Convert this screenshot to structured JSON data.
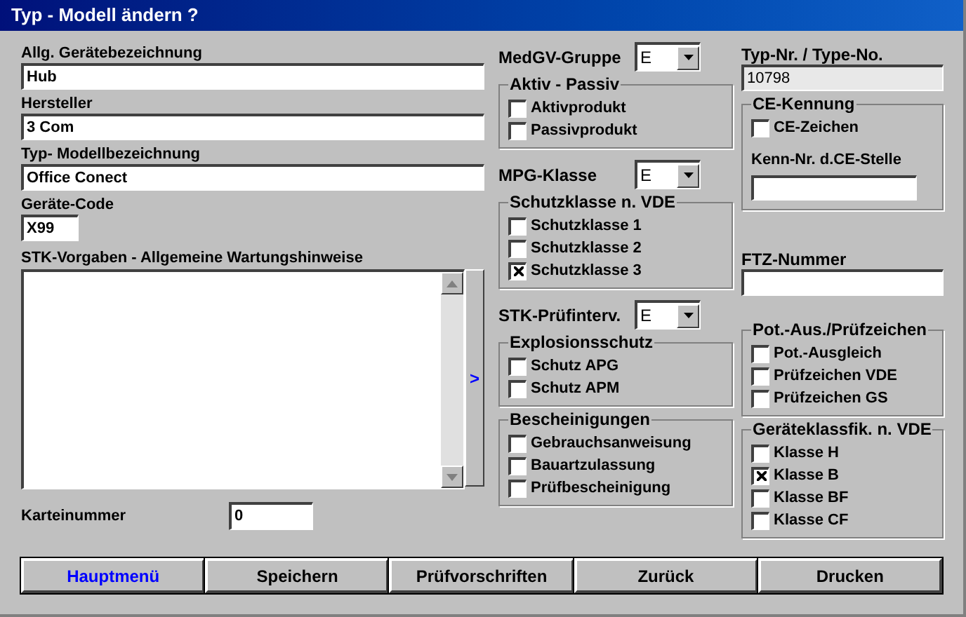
{
  "window": {
    "title": "Typ - Modell ändern ?"
  },
  "left": {
    "fields": [
      {
        "label": "Allg. Gerätebezeichnung",
        "value": "Hub"
      },
      {
        "label": "Hersteller",
        "value": "3 Com"
      },
      {
        "label": "Typ- Modellbezeichnung",
        "value": "Office Conect"
      },
      {
        "label": "Geräte-Code",
        "value": "X99"
      }
    ],
    "notes": {
      "label": "STK-Vorgaben - Allgemeine Wartungshinweise",
      "expand": ">"
    },
    "card_number": {
      "label": "Karteinummer",
      "value": "0"
    }
  },
  "middle": [
    {
      "kind": "dropdown",
      "label": "MedGV-Gruppe",
      "value": "E"
    },
    {
      "kind": "group",
      "title": "Aktiv - Passiv",
      "checks": [
        {
          "label": "Aktivprodukt",
          "checked": false
        },
        {
          "label": "Passivprodukt",
          "checked": false
        }
      ]
    },
    {
      "kind": "dropdown",
      "label": "MPG-Klasse",
      "value": "E"
    },
    {
      "kind": "group",
      "title": "Schutzklasse n. VDE",
      "checks": [
        {
          "label": "Schutzklasse 1",
          "checked": false
        },
        {
          "label": "Schutzklasse 2",
          "checked": false
        },
        {
          "label": "Schutzklasse 3",
          "checked": true
        }
      ]
    },
    {
      "kind": "dropdown",
      "label": "STK-Prüfinterv.",
      "value": "E"
    },
    {
      "kind": "group",
      "title": "Explosionsschutz",
      "checks": [
        {
          "label": "Schutz APG",
          "checked": false
        },
        {
          "label": "Schutz APM",
          "checked": false
        }
      ]
    },
    {
      "kind": "group",
      "title": "Bescheinigungen",
      "checks": [
        {
          "label": "Gebrauchsanweisung",
          "checked": false
        },
        {
          "label": "Bauartzulassung",
          "checked": false
        },
        {
          "label": "Prüfbescheinigung",
          "checked": false
        }
      ]
    }
  ],
  "right": [
    {
      "kind": "field",
      "label": "Typ-Nr. / Type-No.",
      "value": "10798",
      "readonly": true
    },
    {
      "kind": "group",
      "title": "CE-Kennung",
      "checks": [
        {
          "label": "CE-Zeichen",
          "checked": false
        }
      ],
      "field": {
        "label": "Kenn-Nr. d.CE-Stelle"
      }
    },
    {
      "kind": "field",
      "label": "FTZ-Nummer",
      "readonly": false
    },
    {
      "kind": "group",
      "title": "Pot.-Aus./Prüfzeichen",
      "checks": [
        {
          "label": "Pot.-Ausgleich",
          "checked": false
        },
        {
          "label": "Prüfzeichen VDE",
          "checked": false
        },
        {
          "label": "Prüfzeichen GS",
          "checked": false
        }
      ]
    },
    {
      "kind": "group",
      "title": "Geräteklassfik. n. VDE",
      "checks": [
        {
          "label": "Klasse H",
          "checked": false
        },
        {
          "label": "Klasse B",
          "checked": true
        },
        {
          "label": "Klasse BF",
          "checked": false
        },
        {
          "label": "Klasse CF",
          "checked": false
        }
      ]
    }
  ],
  "buttons": [
    {
      "label": "Hauptmenü",
      "highlighted": true
    },
    {
      "label": "Speichern",
      "highlighted": false
    },
    {
      "label": "Prüfvorschriften",
      "highlighted": false
    },
    {
      "label": "Zurück",
      "highlighted": false
    },
    {
      "label": "Drucken",
      "highlighted": false
    }
  ]
}
